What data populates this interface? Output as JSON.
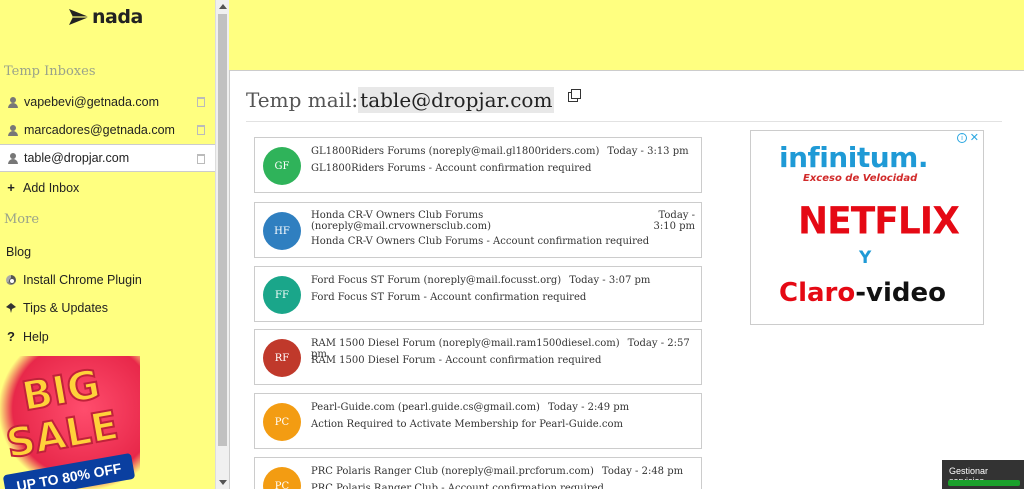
{
  "brand": {
    "name": "nada"
  },
  "sidebar": {
    "temp_inboxes_title": "Temp Inboxes",
    "inboxes": [
      {
        "address": "vapebevi@getnada.com"
      },
      {
        "address": "marcadores@getnada.com"
      },
      {
        "address": "table@dropjar.com"
      }
    ],
    "add_inbox_label": "Add Inbox",
    "more_title": "More",
    "menu": [
      {
        "label": "Blog"
      },
      {
        "label": "Install Chrome Plugin"
      },
      {
        "label": "Tips & Updates"
      },
      {
        "label": "Help"
      }
    ],
    "promo": {
      "big": "BIG",
      "sale": "SALE",
      "off": "UP TO 80% OFF"
    }
  },
  "main": {
    "mail_label": "Temp mail:",
    "mail_address": "table@dropjar.com"
  },
  "messages": [
    {
      "initials": "GF",
      "from": "GL1800Riders Forums (noreply@mail.gl1800riders.com)",
      "time": "Today - 3:13 pm",
      "subject": "GL1800Riders Forums - Account confirmation required",
      "color": "#2fb35a"
    },
    {
      "initials": "HF",
      "from": "Honda CR-V Owners Club Forums (noreply@mail.crvownersclub.com)",
      "time": "Today - 3:10 pm",
      "subject": "Honda CR-V Owners Club Forums - Account confirmation required",
      "color": "#2f7fc0"
    },
    {
      "initials": "FF",
      "from": "Ford Focus ST Forum (noreply@mail.focusst.org)",
      "time": "Today - 3:07 pm",
      "subject": "Ford Focus ST Forum - Account confirmation required",
      "color": "#1aa68a"
    },
    {
      "initials": "RF",
      "from": "RAM 1500 Diesel Forum (noreply@mail.ram1500diesel.com)",
      "time": "Today - 2:57 pm",
      "subject": "RAM 1500 Diesel Forum - Account confirmation required",
      "color": "#c0392b"
    },
    {
      "initials": "PC",
      "from": "Pearl-Guide.com (pearl.guide.cs@gmail.com)",
      "time": "Today - 2:49 pm",
      "subject": "Action Required to Activate Membership for Pearl-Guide.com",
      "color": "#f39c12"
    },
    {
      "initials": "PC",
      "from": "PRC Polaris Ranger Club (noreply@mail.prcforum.com)",
      "time": "Today - 2:48 pm",
      "subject": "PRC Polaris Ranger Club - Account confirmation required",
      "color": "#f39c12"
    }
  ],
  "ad": {
    "brand1": "infinitum.",
    "tagline": "Exceso de Velocidad",
    "brand2": "NETFLIX",
    "conj": "Y",
    "brand3a": "Claro",
    "brand3b": "-video"
  },
  "consent": {
    "label": "Gestionar servicios"
  }
}
